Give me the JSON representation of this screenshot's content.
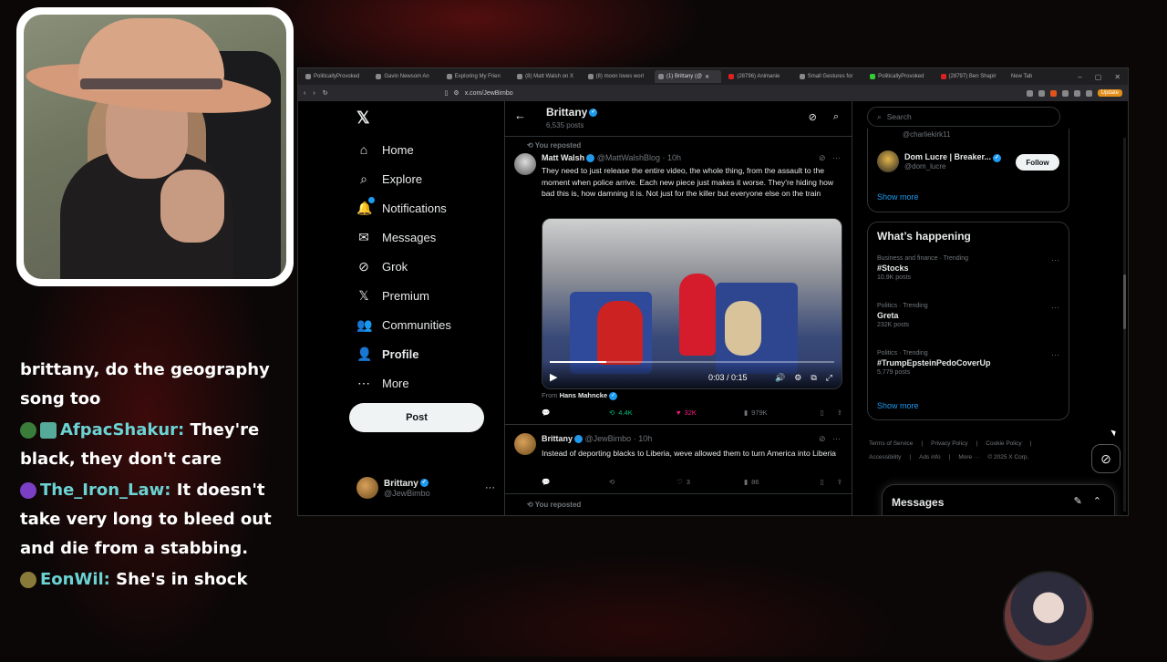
{
  "browser": {
    "tabs": [
      {
        "label": "PoliticallyProvoked",
        "active": false
      },
      {
        "label": "Gavin Newsom An",
        "active": false
      },
      {
        "label": "Exploring My Frien",
        "active": false
      },
      {
        "label": "(8) Matt Walsh on X",
        "active": false
      },
      {
        "label": "(8) moon loves worl",
        "active": false
      },
      {
        "label": "(1) Brittany (@",
        "active": true
      },
      {
        "label": "(28796) Animanie",
        "active": false
      },
      {
        "label": "Small Gestures for",
        "active": false
      },
      {
        "label": "PoliticallyProvoked",
        "active": false
      },
      {
        "label": "(28797) Ben Shapir",
        "active": false
      },
      {
        "label": "New Tab",
        "active": false
      }
    ],
    "url": "x.com/JewBimbo",
    "update_label": "Update"
  },
  "nav": {
    "items": [
      {
        "label": "Home",
        "icon": "⌂",
        "name": "home"
      },
      {
        "label": "Explore",
        "icon": "⌕",
        "name": "explore"
      },
      {
        "label": "Notifications",
        "icon": "🔔",
        "name": "notifications"
      },
      {
        "label": "Messages",
        "icon": "✉",
        "name": "messages"
      },
      {
        "label": "Grok",
        "icon": "⊘",
        "name": "grok"
      },
      {
        "label": "Premium",
        "icon": "𝕏",
        "name": "premium"
      },
      {
        "label": "Communities",
        "icon": "👥",
        "name": "communities"
      },
      {
        "label": "Profile",
        "icon": "👤",
        "name": "profile"
      },
      {
        "label": "More",
        "icon": "⋯",
        "name": "more"
      }
    ],
    "post_label": "Post",
    "user": {
      "name": "Brittany",
      "handle": "@JewBimbo"
    }
  },
  "profile_header": {
    "name": "Brittany",
    "posts": "6,535 posts"
  },
  "tweets": [
    {
      "repost_label": "You reposted",
      "author": "Matt Walsh",
      "handle": "@MattWalshBlog",
      "time": "· 10h",
      "text": "They need to just release the entire video, the whole thing, from the assault to the moment when police arrive. Each new piece just makes it worse. They're hiding how bad this is, how damning it is. Not just for the killer but everyone else on the train",
      "video_time": "0:03 / 0:15",
      "video_progress": 0.2,
      "from_prefix": "From",
      "from_name": "Hans Mahncke",
      "replies": "",
      "reposts": "4.4K",
      "likes": "32K",
      "views": "979K"
    },
    {
      "author": "Brittany",
      "handle": "@JewBimbo",
      "time": "· 10h",
      "text": "Instead of deporting blacks to Liberia, weve allowed them to turn America into Liberia",
      "replies": "",
      "reposts": "",
      "likes": "3",
      "views": "86"
    },
    {
      "repost_label": "You reposted"
    }
  ],
  "right": {
    "search_placeholder": "Search",
    "who_to_follow": {
      "partial_handle": "@charliekirk11",
      "user": {
        "name": "Dom Lucre | Breaker...",
        "handle": "@dom_lucre"
      },
      "follow_label": "Follow",
      "show_more": "Show more"
    },
    "whats_happening": {
      "title": "What’s happening",
      "trends": [
        {
          "category": "Business and finance · Trending",
          "title": "#Stocks",
          "count": "10.9K posts"
        },
        {
          "category": "Politics · Trending",
          "title": "Greta",
          "count": "232K posts"
        },
        {
          "category": "Politics · Trending",
          "title": "#TrumpEpsteinPedoCoverUp",
          "count": "5,779 posts"
        }
      ],
      "show_more": "Show more"
    },
    "footer": [
      "Terms of Service",
      "|",
      "Privacy Policy",
      "|",
      "Cookie Policy",
      "|",
      "Accessibility",
      "|",
      "Ads info",
      "|",
      "More ···",
      "© 2025 X Corp."
    ],
    "messages_label": "Messages"
  },
  "chat": [
    {
      "user": "",
      "text": "brittany, do the geography song too"
    },
    {
      "user": "AfpacShakur:",
      "text": "They're black, they don't care",
      "color": "#6bd3d3"
    },
    {
      "user": "The_Iron_Law:",
      "text": "It doesn't take very long to bleed out and die from a stabbing.",
      "color": "#6bd3d3"
    },
    {
      "user": "EonWil:",
      "text": "She's in shock",
      "color": "#6bd3d3"
    }
  ],
  "colors": {
    "accent": "#1d9bf0",
    "like": "#f91880",
    "repost": "#00ba7c"
  }
}
